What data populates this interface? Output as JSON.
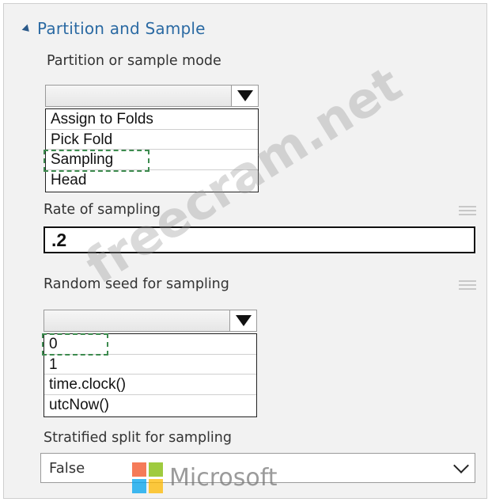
{
  "panel": {
    "title": "Partition and Sample"
  },
  "partition_mode": {
    "label": "Partition or sample mode",
    "selected": "",
    "options": [
      "Assign to Folds",
      "Pick Fold",
      "Sampling",
      "Head"
    ]
  },
  "rate_of_sampling": {
    "label": "Rate of sampling",
    "value": ".2"
  },
  "random_seed": {
    "label": "Random seed for sampling",
    "selected": "",
    "options": [
      "0",
      "1",
      "time.clock()",
      "utcNow()"
    ]
  },
  "stratified_split": {
    "label": "Stratified split for sampling",
    "value": "False"
  },
  "watermarks": {
    "freecram": "freecram.net",
    "microsoft": "Microsoft"
  },
  "colors": {
    "title": "#2b6aa3",
    "highlight_dash": "#3d8b4f",
    "ms_red": "#f25022",
    "ms_green": "#7fba00",
    "ms_blue": "#00a4ef",
    "ms_yellow": "#ffb900"
  }
}
